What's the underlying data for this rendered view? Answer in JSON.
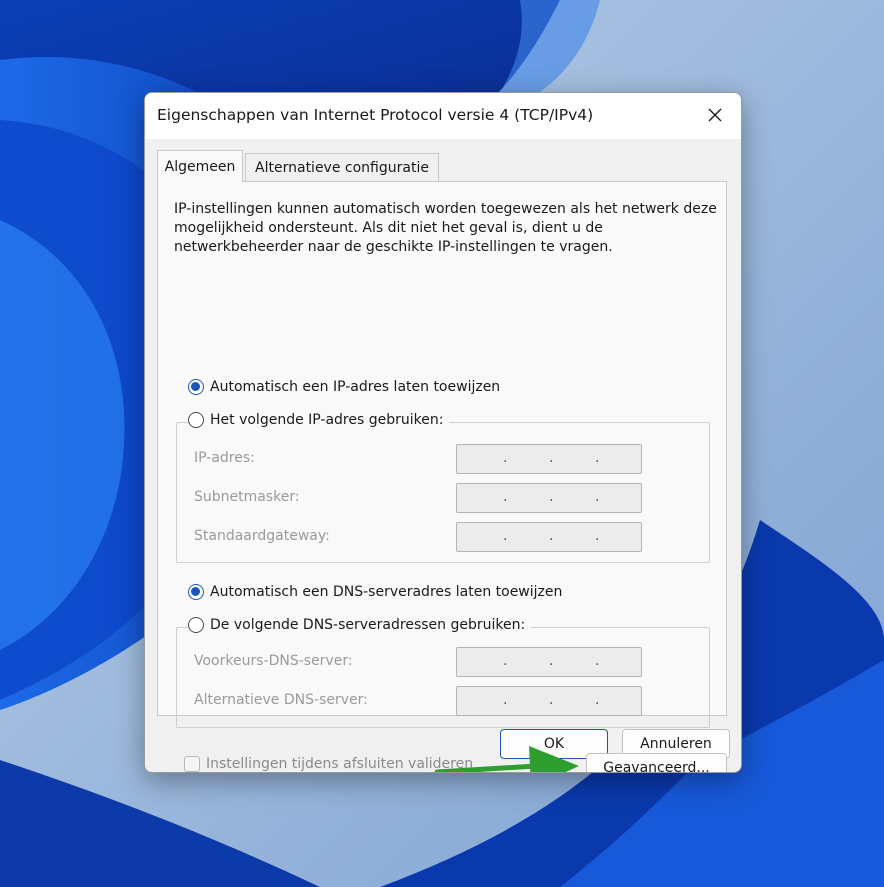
{
  "window": {
    "title": "Eigenschappen van Internet Protocol versie 4 (TCP/IPv4)"
  },
  "tabs": [
    {
      "label": "Algemeen",
      "active": true
    },
    {
      "label": "Alternatieve configuratie",
      "active": false
    }
  ],
  "general": {
    "intro": "IP-instellingen kunnen automatisch worden toegewezen als het netwerk deze mogelijkheid ondersteunt. Als dit niet het geval is, dient u de netwerkbeheerder naar de geschikte IP-instellingen te vragen.",
    "ip_auto_label": "Automatisch een IP-adres laten toewijzen",
    "ip_auto_selected": true,
    "ip_manual_label": "Het volgende IP-adres gebruiken:",
    "ip_manual_selected": false,
    "ip_fields": [
      {
        "label": "IP-adres:",
        "value": ". . ."
      },
      {
        "label": "Subnetmasker:",
        "value": ". . ."
      },
      {
        "label": "Standaardgateway:",
        "value": ". . ."
      }
    ],
    "dns_auto_label": "Automatisch een DNS-serveradres laten toewijzen",
    "dns_auto_selected": true,
    "dns_manual_label": "De volgende DNS-serveradressen gebruiken:",
    "dns_manual_selected": false,
    "dns_fields": [
      {
        "label": "Voorkeurs-DNS-server:",
        "value": ". . ."
      },
      {
        "label": "Alternatieve DNS-server:",
        "value": ". . ."
      }
    ],
    "validate_label": "Instellingen tijdens afsluiten valideren",
    "validate_checked": false,
    "advanced_label": "Geavanceerd..."
  },
  "footer": {
    "ok_label": "OK",
    "cancel_label": "Annuleren"
  },
  "colors": {
    "accent": "#1d56b8",
    "annotation_arrow": "#2e9e2e"
  },
  "icons": {
    "close": "close-icon",
    "annotation": "arrow-right-icon"
  }
}
